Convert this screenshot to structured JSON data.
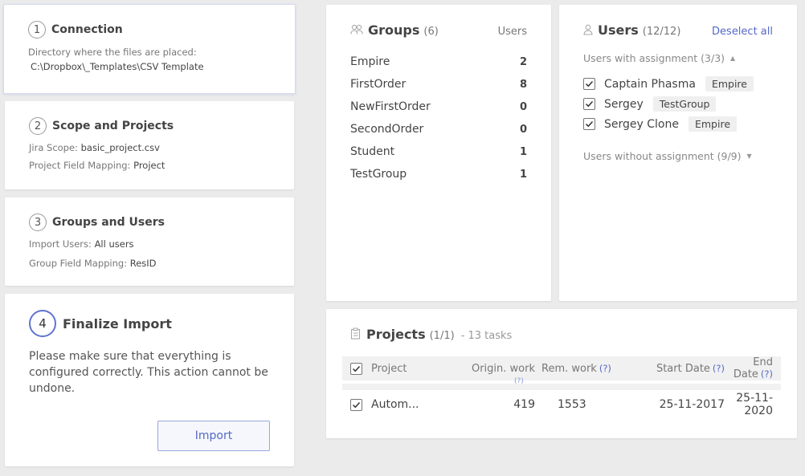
{
  "steps": [
    {
      "num": "1",
      "title": "Connection",
      "lines": [
        {
          "text": "Directory where the files are placed:"
        },
        {
          "text": "C:\\Dropbox\\_Templates\\CSV Template"
        }
      ]
    },
    {
      "num": "2",
      "title": "Scope and Projects",
      "lines": [
        {
          "label": "Jira Scope: ",
          "value": "basic_project.csv"
        },
        {
          "label": "Project Field Mapping: ",
          "value": "Project"
        }
      ]
    },
    {
      "num": "3",
      "title": "Groups and Users",
      "lines": [
        {
          "label": "Import Users: ",
          "value": "All users"
        },
        {
          "label": "Group Field Mapping: ",
          "value": "ResID"
        }
      ]
    }
  ],
  "finalize": {
    "num": "4",
    "title": "Finalize Import",
    "text": "Please make sure that everything is configured correctly. This action cannot be undone.",
    "button": "Import"
  },
  "groups": {
    "title": "Groups",
    "count": "(6)",
    "users_col": "Users",
    "icon": "groups-icon",
    "items": [
      {
        "name": "Empire",
        "users": "2"
      },
      {
        "name": "FirstOrder",
        "users": "8"
      },
      {
        "name": "NewFirstOrder",
        "users": "0"
      },
      {
        "name": "SecondOrder",
        "users": "0"
      },
      {
        "name": "Student",
        "users": "1"
      },
      {
        "name": "TestGroup",
        "users": "1"
      }
    ]
  },
  "users": {
    "title": "Users",
    "count": "(12/12)",
    "deselect": "Deselect all",
    "icon": "user-icon",
    "with_assignment": "Users with assignment (3/3)",
    "without_assignment": "Users without assignment (9/9)",
    "items": [
      {
        "name": "Captain Phasma",
        "group": "Empire",
        "checked": true
      },
      {
        "name": "Sergey",
        "group": "TestGroup",
        "checked": true
      },
      {
        "name": "Sergey Clone",
        "group": "Empire",
        "checked": true
      }
    ]
  },
  "projects": {
    "title": "Projects",
    "count": "(1/1)",
    "tasks": "- 13 tasks",
    "icon": "clipboard-icon",
    "columns": {
      "project": "Project",
      "orig": "Origin. work",
      "rem": "Rem. work",
      "start": "Start Date",
      "end": "End Date",
      "help": "(?)"
    },
    "rows": [
      {
        "name": "Autom...",
        "orig": "419",
        "rem": "1553",
        "start": "25-11-2017",
        "end": "25-11-2020",
        "checked": true
      }
    ]
  },
  "colors": {
    "accent": "#5468c8",
    "background": "#ebebeb"
  }
}
